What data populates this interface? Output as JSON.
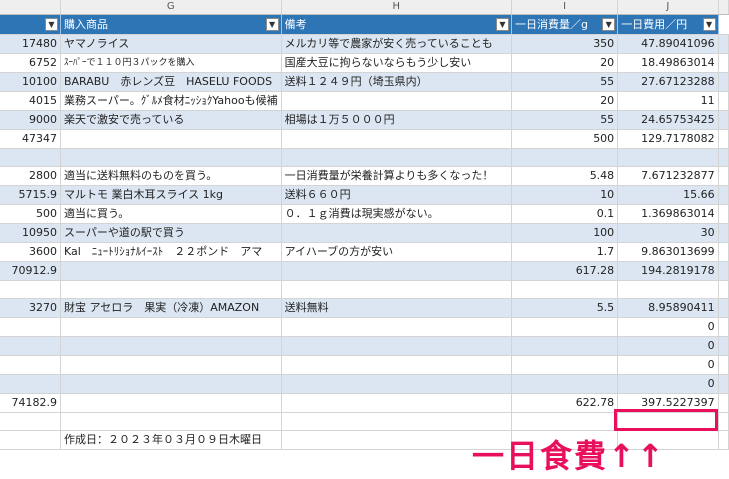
{
  "columns": [
    "G",
    "H",
    "I",
    "J"
  ],
  "header": {
    "purchase": "購入商品",
    "notes": "備考",
    "daily_qty": "一日消費量／g",
    "daily_cost": "一日費用／円"
  },
  "rows": [
    {
      "band": true,
      "amount": "17480",
      "item": "ヤマノライス",
      "note": "メルカリ等で農家が安く売っていることも",
      "qty": "350",
      "cost": "47.89041096"
    },
    {
      "band": false,
      "amount": "6752",
      "item": "ｽｰﾊﾟｰで１１０円３パックを購入",
      "note": "国産大豆に拘らないならもう少し安い",
      "qty": "20",
      "cost": "18.49863014",
      "small_item": true
    },
    {
      "band": true,
      "amount": "10100",
      "item": "BARABU　赤レンズ豆　HASELU FOODS",
      "note": "送料１２４９円（埼玉県内）",
      "qty": "55",
      "cost": "27.67123288"
    },
    {
      "band": false,
      "amount": "4015",
      "item": "業務スーパー。ｸﾞﾙﾒ食材ﾆｯｼｮｸYahooも候補",
      "note": "",
      "qty": "20",
      "cost": "11"
    },
    {
      "band": true,
      "amount": "9000",
      "item": "楽天で激安で売っている",
      "note": "相場は１万５０００円",
      "qty": "55",
      "cost": "24.65753425"
    },
    {
      "band": false,
      "amount": "47347",
      "item": "",
      "note": "",
      "qty": "500",
      "cost": "129.7178082"
    },
    {
      "band": true,
      "amount": "",
      "item": "",
      "note": "",
      "qty": "",
      "cost": ""
    },
    {
      "band": false,
      "amount": "2800",
      "item": "適当に送料無料のものを買う。",
      "note": "一日消費量が栄養計算よりも多くなった！",
      "qty": "5.48",
      "cost": "7.671232877"
    },
    {
      "band": true,
      "amount": "5715.9",
      "item": "マルトモ 業白木耳スライス 1kg",
      "note": "送料６６０円",
      "qty": "10",
      "cost": "15.66"
    },
    {
      "band": false,
      "amount": "500",
      "item": "適当に買う。",
      "note": "０．１ｇ消費は現実感がない。",
      "qty": "0.1",
      "cost": "1.369863014"
    },
    {
      "band": true,
      "amount": "10950",
      "item": "スーパーや道の駅で買う",
      "note": "",
      "qty": "100",
      "cost": "30"
    },
    {
      "band": false,
      "amount": "3600",
      "item": "Kal　ﾆｭｰﾄﾘｼｮﾅﾙｲｰｽﾄ　２２ポンド　アマ",
      "note": "アイハーブの方が安い",
      "qty": "1.7",
      "cost": "9.863013699"
    },
    {
      "band": true,
      "amount": "70912.9",
      "item": "",
      "note": "",
      "qty": "617.28",
      "cost": "194.2819178"
    },
    {
      "band": false,
      "amount": "",
      "item": "",
      "note": "",
      "qty": "",
      "cost": ""
    },
    {
      "band": true,
      "amount": "3270",
      "item": "財宝 アセロラ　果実（冷凍）AMAZON",
      "note": "送料無料",
      "qty": "5.5",
      "cost": "8.95890411"
    },
    {
      "band": false,
      "amount": "",
      "item": "",
      "note": "",
      "qty": "",
      "cost": "0"
    },
    {
      "band": true,
      "amount": "",
      "item": "",
      "note": "",
      "qty": "",
      "cost": "0"
    },
    {
      "band": false,
      "amount": "",
      "item": "",
      "note": "",
      "qty": "",
      "cost": "0"
    },
    {
      "band": true,
      "amount": "",
      "item": "",
      "note": "",
      "qty": "",
      "cost": "0"
    },
    {
      "band": false,
      "amount": "74182.9",
      "item": "",
      "note": "",
      "qty": "622.78",
      "cost": "397.5227397"
    },
    {
      "band": false,
      "amount": "",
      "item": "",
      "note": "",
      "qty": "",
      "cost": ""
    },
    {
      "band": false,
      "amount": "",
      "item": "作成日：２０２３年０３月０９日木曜日",
      "note": "",
      "qty": "",
      "cost": ""
    }
  ],
  "annotation": {
    "text": "一日食費↑↑",
    "color": "#e8105c"
  },
  "colors": {
    "header_bg": "#2e75b6",
    "band_bg": "#dce6f2",
    "highlight": "#e8105c"
  }
}
